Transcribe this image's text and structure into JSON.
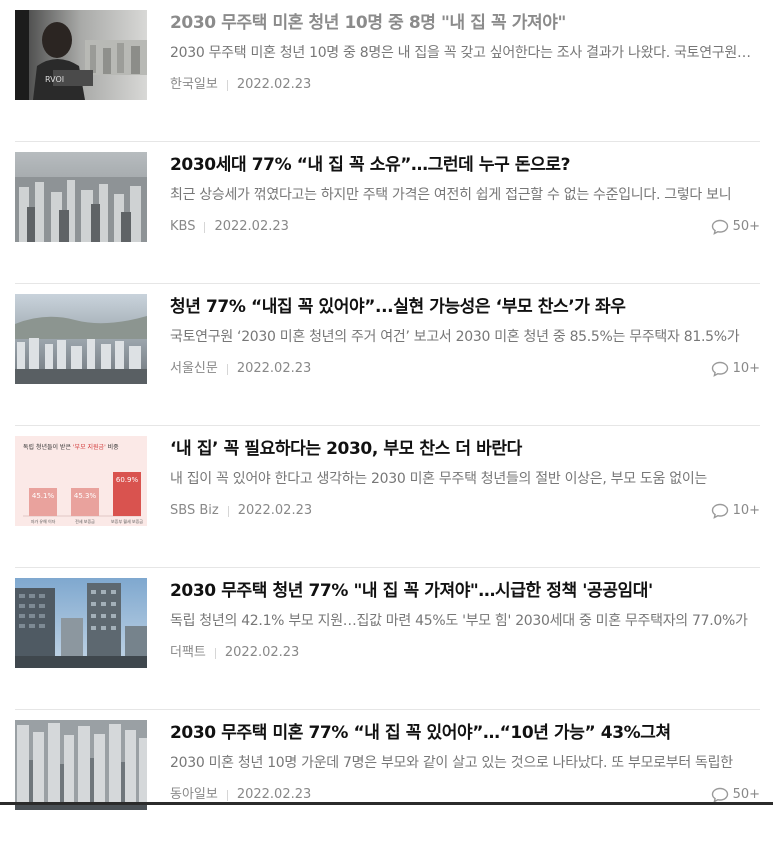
{
  "articles": [
    {
      "title": "2030 무주택 미혼 청년 10명 중 8명 \"내 집 꼭 가져야\"",
      "summary": "2030 무주택 미혼 청년 10명 중 8명은 내 집을 꼭 갖고 싶어한다는 조사 결과가 나왔다. 국토연구원 보고서",
      "source": "한국일보",
      "date": "2022.02.23",
      "comments": "",
      "visited": true,
      "thumb": "person-window-city"
    },
    {
      "title": "2030세대 77% “내 집 꼭 소유”…그런데 누구 돈으로?",
      "summary": "최근 상승세가 꺾였다고는 하지만 주택 가격은 여전히 쉽게 접근할 수 없는 수준입니다. 그렇다 보니",
      "source": "KBS",
      "date": "2022.02.23",
      "comments": "50+",
      "visited": false,
      "thumb": "apartment-aerial"
    },
    {
      "title": "청년 77% “내집 꼭 있어야”...실현 가능성은 ‘부모 찬스’가 좌우",
      "summary": "국토연구원 ‘2030 미혼 청년의 주거 여건’ 보고서 2030 미혼 청년 중 85.5%는 무주택자 81.5%가",
      "source": "서울신문",
      "date": "2022.02.23",
      "comments": "10+",
      "visited": false,
      "thumb": "city-skyline"
    },
    {
      "title": "‘내 집’ 꼭 필요하다는 2030, 부모 찬스 더 바란다",
      "summary": "내 집이 꼭 있어야 한다고 생각하는 2030 미혼 무주택 청년들의 절반 이상은, 부모 도움 없이는",
      "source": "SBS Biz",
      "date": "2022.02.23",
      "comments": "10+",
      "visited": false,
      "thumb": "bar-graphic",
      "thumb_text": {
        "heading_a": "독립 청년들이 받은",
        "heading_b": "'부모 지원금'",
        "heading_c": "비중",
        "bars": [
          {
            "value": "45.1%",
            "label": "자가 유해 이자"
          },
          {
            "value": "45.3%",
            "label": "전세 보증금"
          },
          {
            "value": "60.9%",
            "label": "보증부 월세 보증금"
          }
        ]
      }
    },
    {
      "title": "2030 무주택 청년 77% \"내 집 꼭 가져야\"…시급한 정책 '공공임대'",
      "summary": "독립 청년의 42.1% 부모 지원…집값 마련 45%도 '부모 힘' 2030세대 중 미혼 무주택자의 77.0%가",
      "source": "더팩트",
      "date": "2022.02.23",
      "comments": "",
      "visited": false,
      "thumb": "tower-blocks"
    },
    {
      "title": "2030 무주택 미혼 77% “내 집 꼭 있어야”…“10년 가능” 43%그쳐",
      "summary": "2030 미혼 청년 10명 가운데 7명은 부모와 같이 살고 있는 것으로 나타났다. 또 부모로부터 독립한",
      "source": "동아일보",
      "date": "2022.02.23",
      "comments": "50+",
      "visited": false,
      "thumb": "dense-apartments"
    }
  ]
}
